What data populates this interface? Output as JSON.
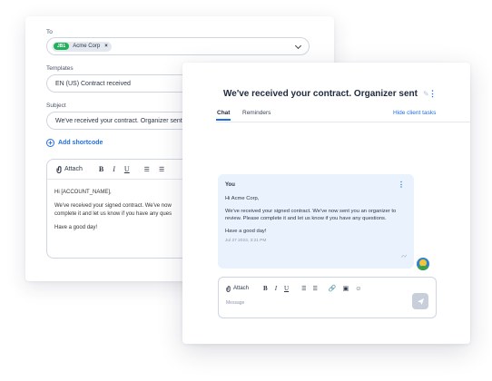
{
  "email_form": {
    "to": {
      "label": "To",
      "chip_badge": "JB1",
      "chip_name": "Acme Corp"
    },
    "templates": {
      "label": "Templates",
      "value": "EN (US) Contract received"
    },
    "subject": {
      "label": "Subject",
      "value": "We've received your contract. Organizer sent"
    },
    "add_shortcode": "Add shortcode",
    "editor": {
      "attach_label": "Attach",
      "bold": "B",
      "italic": "I",
      "underline": "U",
      "body": [
        "Hi [ACCOUNT_NAME],",
        "We've received your signed contract. We've now",
        "complete it and let us know if you have any ques",
        "Have a good day!"
      ]
    }
  },
  "chat": {
    "title": "We've received your contract. Organizer sent",
    "tabs": {
      "chat": "Chat",
      "reminders": "Reminders",
      "hide_client_tasks": "Hide client tasks"
    },
    "message": {
      "sender": "You",
      "greeting": "Hi Acme Corp,",
      "body": "We've received your signed contract. We've now sent you an organizer to review. Please complete it and let us know if you have any questions.",
      "closing": "Have a good day!",
      "timestamp": "Jul 27 2023, 3:21 PM"
    },
    "composer": {
      "attach_label": "Attach",
      "bold": "B",
      "italic": "I",
      "underline": "U",
      "placeholder": "Message"
    }
  },
  "colors": {
    "accent": "#1f6fe5",
    "chip_badge": "#20b15a",
    "bubble": "#eaf2fd"
  }
}
